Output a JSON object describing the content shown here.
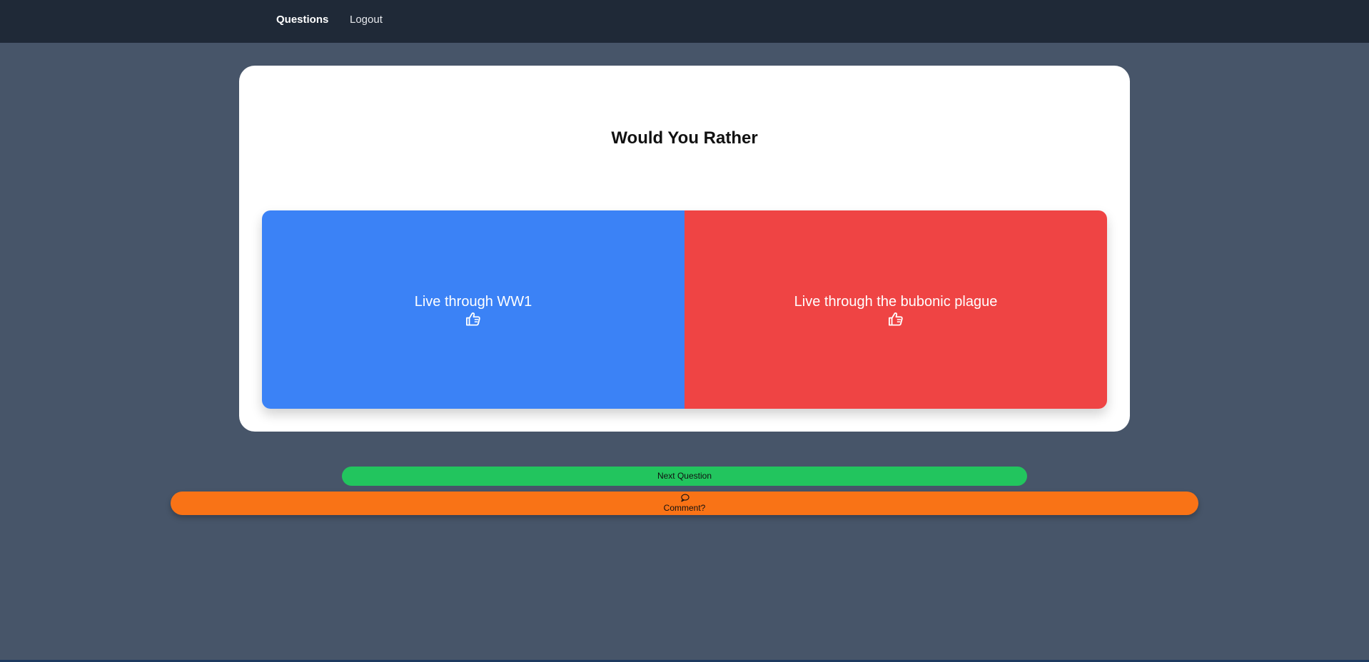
{
  "nav": {
    "items": [
      {
        "label": "Questions"
      },
      {
        "label": "Logout"
      }
    ]
  },
  "card": {
    "title": "Would You Rather",
    "options": [
      {
        "label": "Live through WW1",
        "icon": "thumbs-up-icon",
        "color": "#3b82f6"
      },
      {
        "label": "Live through the bubonic plague",
        "icon": "thumbs-up-icon",
        "color": "#ef4444"
      }
    ]
  },
  "actions": {
    "next_label": "Next Question",
    "next_color": "#22c55e",
    "comment_label": "Comment?",
    "comment_icon": "speech-bubble-icon",
    "comment_color": "#f97316"
  },
  "theme": {
    "navbar_bg": "#1f2937",
    "page_bg": "#475569"
  }
}
